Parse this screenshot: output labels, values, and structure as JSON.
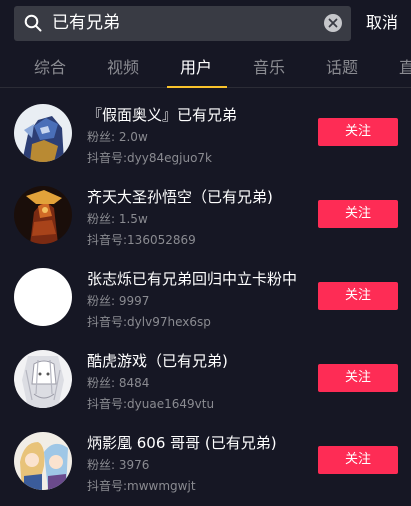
{
  "search": {
    "query": "已有兄弟",
    "cancel_label": "取消"
  },
  "tabs": [
    {
      "label": "综合"
    },
    {
      "label": "视频"
    },
    {
      "label": "用户"
    },
    {
      "label": "音乐"
    },
    {
      "label": "话题"
    },
    {
      "label": "直"
    }
  ],
  "active_tab": "用户",
  "users": [
    {
      "name": "『假面奥义』已有兄弟",
      "fans": "粉丝: 2.0w",
      "douyin_id": "抖音号:dyy84egjuo7k",
      "follow_label": "关注"
    },
    {
      "name": "齐天大圣孙悟空（已有兄弟)",
      "fans": "粉丝: 1.5w",
      "douyin_id": "抖音号:136052869",
      "follow_label": "关注"
    },
    {
      "name": "张志烁已有兄弟回归中立卡粉中",
      "fans": "粉丝: 9997",
      "douyin_id": "抖音号:dylv97hex6sp",
      "follow_label": "关注"
    },
    {
      "name": "酷虎游戏（已有兄弟)",
      "fans": "粉丝: 8484",
      "douyin_id": "抖音号:dyuae1649vtu",
      "follow_label": "关注"
    },
    {
      "name": "炳影凰 606 哥哥 (已有兄弟)",
      "fans": "粉丝: 3976",
      "douyin_id": "抖音号:mwwmgwjt",
      "follow_label": "关注"
    }
  ],
  "colors": {
    "background": "#161724",
    "search_bg": "#393b44",
    "follow_button": "#fe2c55",
    "tab_indicator": "#f9c32c",
    "secondary_text": "#8a8b91"
  }
}
